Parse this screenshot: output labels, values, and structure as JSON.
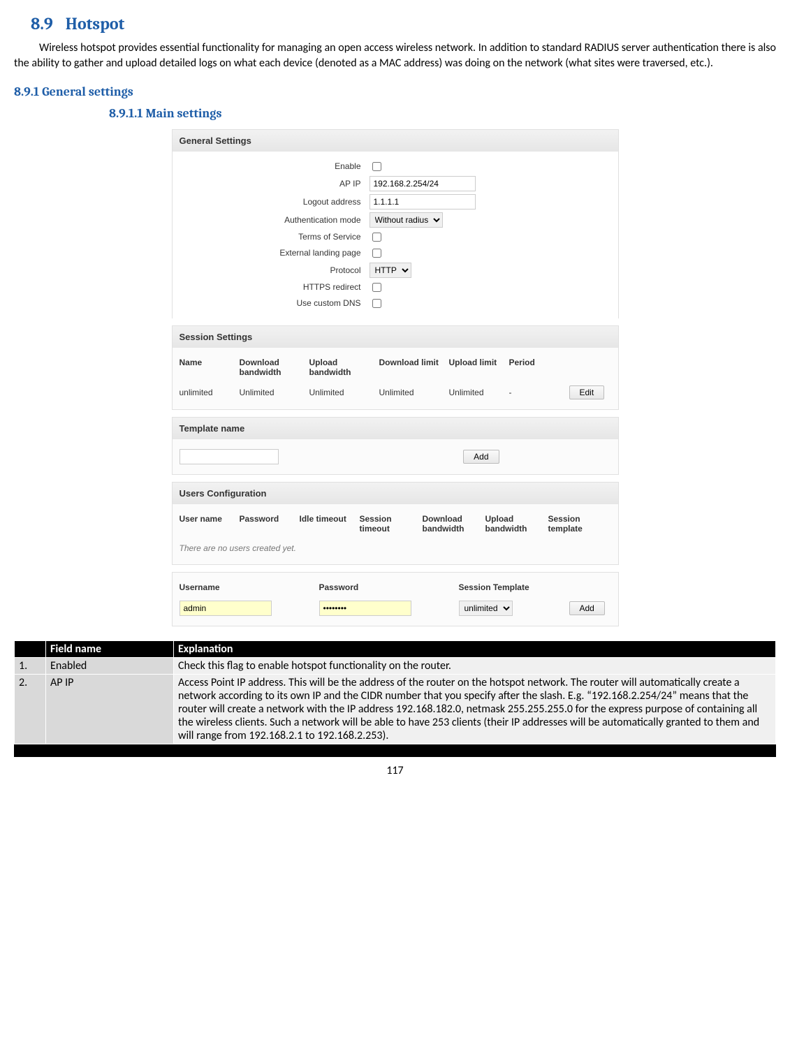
{
  "headings": {
    "h2_num": "8.9",
    "h2_text": "Hotspot",
    "h3": "8.9.1  General settings",
    "h4": "8.9.1.1    Main settings"
  },
  "intro": "Wireless hotspot provides essential functionality for managing an open access wireless network. In addition to standard RADIUS server authentication there is also the ability to gather and upload detailed logs on what each device (denoted as a MAC address) was doing on the network (what sites were traversed, etc.).",
  "general": {
    "title": "General Settings",
    "enable_label": "Enable",
    "apip_label": "AP IP",
    "apip_value": "192.168.2.254/24",
    "logout_label": "Logout address",
    "logout_value": "1.1.1.1",
    "auth_label": "Authentication mode",
    "auth_value": "Without radius",
    "tos_label": "Terms of Service",
    "ext_label": "External landing page",
    "proto_label": "Protocol",
    "proto_value": "HTTP",
    "https_label": "HTTPS redirect",
    "dns_label": "Use custom DNS"
  },
  "session": {
    "title": "Session Settings",
    "cols": {
      "name": "Name",
      "dlbw": "Download bandwidth",
      "ulbw": "Upload bandwidth",
      "dll": "Download limit",
      "ull": "Upload limit",
      "period": "Period"
    },
    "row": {
      "name": "unlimited",
      "dlbw": "Unlimited",
      "ulbw": "Unlimited",
      "dll": "Unlimited",
      "ull": "Unlimited",
      "period": "-"
    },
    "edit": "Edit",
    "template_label": "Template name",
    "add": "Add"
  },
  "users": {
    "title": "Users Configuration",
    "cols": {
      "un": "User name",
      "pw": "Password",
      "idle": "Idle timeout",
      "sess": "Session timeout",
      "dlbw": "Download bandwidth",
      "ulbw": "Upload bandwidth",
      "tmpl": "Session template"
    },
    "empty": "There are no users created yet.",
    "add_cols": {
      "un": "Username",
      "pw": "Password",
      "tmpl": "Session Template"
    },
    "add_row": {
      "un": "admin",
      "pw": "••••••••",
      "tmpl": "unlimited"
    },
    "add": "Add"
  },
  "table": {
    "head": {
      "c1": "",
      "c2": "Field name",
      "c3": "Explanation"
    },
    "rows": [
      {
        "n": "1.",
        "field": "Enabled",
        "text": "Check this flag to enable hotspot functionality on the router."
      },
      {
        "n": "2.",
        "field": "AP IP",
        "text": "Access Point IP address. This will be the address of the router on the hotspot network. The router will automatically create a network according to its own IP and the CIDR number that you specify after the slash. E.g. “192.168.2.254/24” means that the router will create a network with the IP address 192.168.182.0, netmask 255.255.255.0 for the express purpose of containing all the wireless clients. Such a network will be able to have 253 clients (their IP addresses will be automatically granted to them and will range from 192.168.2.1 to 192.168.2.253)."
      }
    ]
  },
  "pagenum": "117"
}
